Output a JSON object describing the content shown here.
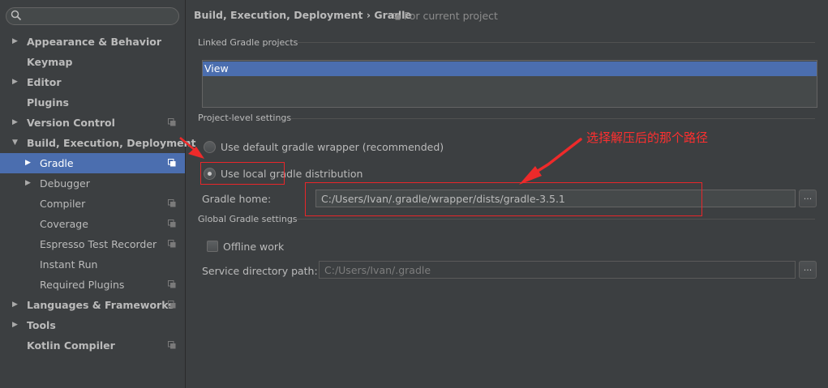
{
  "sidebar": {
    "search_placeholder": "",
    "items": [
      {
        "label": "Appearance & Behavior",
        "expandable": true,
        "expanded": false,
        "bold": true,
        "level": 0,
        "project_icon": false,
        "selected": false
      },
      {
        "label": "Keymap",
        "expandable": false,
        "bold": true,
        "level": 0,
        "project_icon": false,
        "selected": false
      },
      {
        "label": "Editor",
        "expandable": true,
        "expanded": false,
        "bold": true,
        "level": 0,
        "project_icon": false,
        "selected": false
      },
      {
        "label": "Plugins",
        "expandable": false,
        "bold": true,
        "level": 0,
        "project_icon": false,
        "selected": false
      },
      {
        "label": "Version Control",
        "expandable": true,
        "expanded": false,
        "bold": true,
        "level": 0,
        "project_icon": true,
        "selected": false
      },
      {
        "label": "Build, Execution, Deployment",
        "expandable": true,
        "expanded": true,
        "bold": true,
        "level": 0,
        "project_icon": false,
        "selected": false
      },
      {
        "label": "Gradle",
        "expandable": true,
        "expanded": false,
        "bold": false,
        "level": 1,
        "project_icon": true,
        "selected": true
      },
      {
        "label": "Debugger",
        "expandable": true,
        "expanded": false,
        "bold": false,
        "level": 1,
        "project_icon": false,
        "selected": false
      },
      {
        "label": "Compiler",
        "expandable": false,
        "bold": false,
        "level": 1,
        "project_icon": true,
        "selected": false
      },
      {
        "label": "Coverage",
        "expandable": false,
        "bold": false,
        "level": 1,
        "project_icon": true,
        "selected": false
      },
      {
        "label": "Espresso Test Recorder",
        "expandable": false,
        "bold": false,
        "level": 1,
        "project_icon": true,
        "selected": false
      },
      {
        "label": "Instant Run",
        "expandable": false,
        "bold": false,
        "level": 1,
        "project_icon": false,
        "selected": false
      },
      {
        "label": "Required Plugins",
        "expandable": false,
        "bold": false,
        "level": 1,
        "project_icon": true,
        "selected": false
      },
      {
        "label": "Languages & Frameworks",
        "expandable": true,
        "expanded": false,
        "bold": true,
        "level": 0,
        "project_icon": true,
        "selected": false
      },
      {
        "label": "Tools",
        "expandable": true,
        "expanded": false,
        "bold": true,
        "level": 0,
        "project_icon": false,
        "selected": false
      },
      {
        "label": "Kotlin Compiler",
        "expandable": false,
        "bold": true,
        "level": 0,
        "project_icon": true,
        "selected": false
      }
    ]
  },
  "breadcrumb": {
    "text": "Build, Execution, Deployment › Gradle",
    "scope": "For current project"
  },
  "linked": {
    "title": "Linked Gradle projects",
    "projects": [
      "View"
    ]
  },
  "project_level": {
    "title": "Project-level settings",
    "option_wrapper": "Use default gradle wrapper (recommended)",
    "option_local": "Use local gradle distribution",
    "selected": "local",
    "gradle_home_label": "Gradle home:",
    "gradle_home_value": "C:/Users/Ivan/.gradle/wrapper/dists/gradle-3.5.1",
    "browse": "..."
  },
  "global": {
    "title": "Global Gradle settings",
    "offline_label": "Offline work",
    "offline_checked": false,
    "service_label": "Service directory path:",
    "service_value": "C:/Users/Ivan/.gradle",
    "browse": "..."
  },
  "annotation": {
    "text": "选择解压后的那个路径",
    "color": "#ff2f2f"
  },
  "colors": {
    "background": "#3c3f41",
    "selection": "#4b6eaf",
    "text": "#bbbbbb"
  }
}
